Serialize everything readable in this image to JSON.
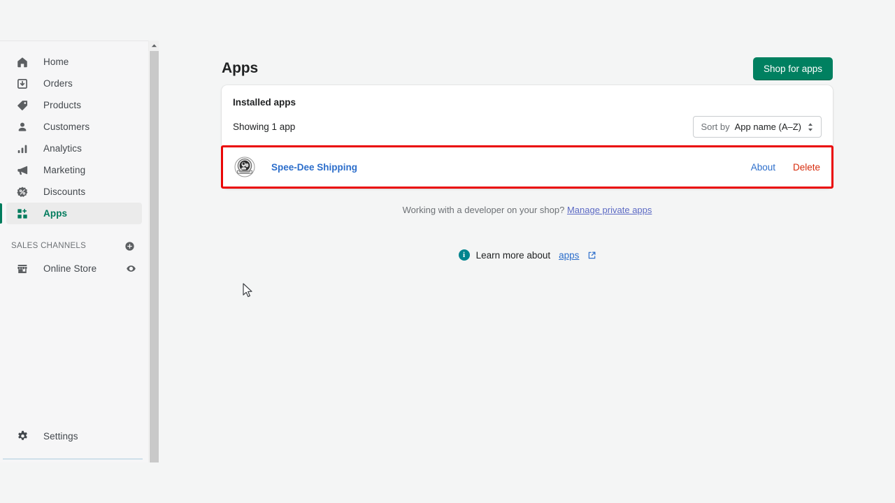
{
  "sidebar": {
    "items": [
      {
        "label": "Home",
        "icon": "home-icon",
        "active": false
      },
      {
        "label": "Orders",
        "icon": "orders-icon",
        "active": false
      },
      {
        "label": "Products",
        "icon": "products-tag-icon",
        "active": false
      },
      {
        "label": "Customers",
        "icon": "customers-person-icon",
        "active": false
      },
      {
        "label": "Analytics",
        "icon": "analytics-bars-icon",
        "active": false
      },
      {
        "label": "Marketing",
        "icon": "marketing-megaphone-icon",
        "active": false
      },
      {
        "label": "Discounts",
        "icon": "discounts-percent-icon",
        "active": false
      },
      {
        "label": "Apps",
        "icon": "apps-grid-icon",
        "active": true
      }
    ],
    "section_title": "SALES CHANNELS",
    "section_add_icon": "plus-circle-icon",
    "channels": [
      {
        "label": "Online Store",
        "icon": "storefront-icon",
        "trailing_icon": "eye-icon"
      }
    ],
    "settings": {
      "label": "Settings",
      "icon": "gear-icon"
    },
    "scroll_up_icon": "chevron-up-icon"
  },
  "header": {
    "title": "Apps",
    "shop_button_label": "Shop for apps"
  },
  "card": {
    "title": "Installed apps",
    "showing_count": "Showing 1 app",
    "sort": {
      "label": "Sort by",
      "value": "App name (A–Z)",
      "caret_icon": "sort-updown-icon"
    }
  },
  "installed_apps": [
    {
      "name": "Spee-Dee Shipping",
      "icon": "spee-dee-shipping-app-icon",
      "about_label": "About",
      "delete_label": "Delete",
      "highlighted": true
    }
  ],
  "dev_footer": {
    "text": "Working with a developer on your shop?",
    "link_label": "Manage private apps"
  },
  "learn_more": {
    "info_icon": "info-circle-icon",
    "text": "Learn more about",
    "link_label": "apps",
    "external_icon": "external-link-icon"
  },
  "colors": {
    "page_background": "#f4f5f5",
    "sidebar_background": "#f6f6f7",
    "accent_green": "#008060",
    "active_green": "#007b5c",
    "link_blue": "#2c6ecb",
    "private_apps_link": "#5c6ac4",
    "delete_red": "#d72c0d",
    "highlight_red": "#ea0606",
    "info_teal": "#00848e"
  }
}
